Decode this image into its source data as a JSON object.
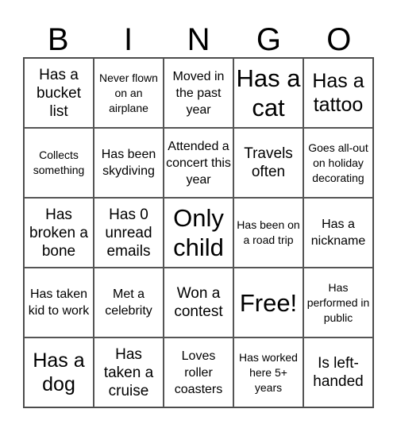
{
  "header": [
    "B",
    "I",
    "N",
    "G",
    "O"
  ],
  "cells": [
    {
      "text": "Has a bucket list",
      "size": "m"
    },
    {
      "text": "Never flown on an airplane",
      "size": "xs"
    },
    {
      "text": "Moved in the past year",
      "size": "s"
    },
    {
      "text": "Has a cat",
      "size": "xl"
    },
    {
      "text": "Has a tattoo",
      "size": "l"
    },
    {
      "text": "Collects something",
      "size": "xs"
    },
    {
      "text": "Has been skydiving",
      "size": "s"
    },
    {
      "text": "Attended a concert this year",
      "size": "s"
    },
    {
      "text": "Travels often",
      "size": "m"
    },
    {
      "text": "Goes all-out on holiday decorating",
      "size": "xs"
    },
    {
      "text": "Has broken a bone",
      "size": "m"
    },
    {
      "text": "Has 0 unread emails",
      "size": "m"
    },
    {
      "text": "Only child",
      "size": "xl"
    },
    {
      "text": "Has been on a road trip",
      "size": "xs"
    },
    {
      "text": "Has a nickname",
      "size": "s"
    },
    {
      "text": "Has taken kid to work",
      "size": "s"
    },
    {
      "text": "Met a celebrity",
      "size": "s"
    },
    {
      "text": "Won a contest",
      "size": "m"
    },
    {
      "text": "Free!",
      "size": "xl"
    },
    {
      "text": "Has performed in public",
      "size": "xs"
    },
    {
      "text": "Has a dog",
      "size": "l"
    },
    {
      "text": "Has taken a cruise",
      "size": "m"
    },
    {
      "text": "Loves roller coasters",
      "size": "s"
    },
    {
      "text": "Has worked here 5+ years",
      "size": "xs"
    },
    {
      "text": "Is left-handed",
      "size": "m"
    }
  ]
}
